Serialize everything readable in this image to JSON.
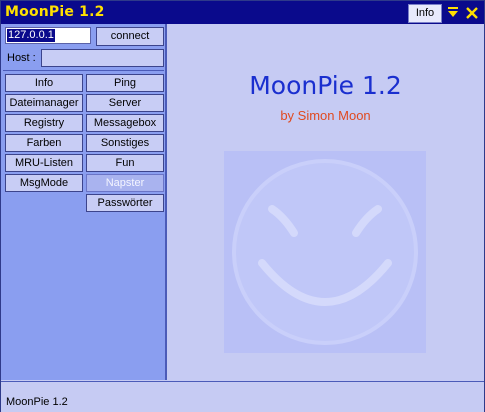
{
  "window": {
    "title": "MoonPie 1.2",
    "info_tab": "Info",
    "minimize_glyph": "▼",
    "close_glyph": "✕"
  },
  "connection": {
    "ip_value": "127.0.0.1",
    "connect_label": "connect",
    "host_label": "Host :",
    "host_value": ""
  },
  "buttons": {
    "left": [
      "Info",
      "Dateimanager",
      "Registry",
      "Farben",
      "MRU-Listen",
      "MsgMode"
    ],
    "right": [
      "Ping",
      "Server",
      "Messagebox",
      "Sonstiges",
      "Fun",
      "Napster",
      "Passwörter"
    ]
  },
  "main": {
    "title": "MoonPie 1.2",
    "subtitle": "by Simon Moon"
  },
  "status": {
    "text": "MoonPie 1.2"
  },
  "colors": {
    "titlebar": "#0a0a8c",
    "title_text": "#ffe000",
    "main_title": "#1a2fcf",
    "subtitle": "#e04a20",
    "left_panel": "#8a9ef0"
  }
}
